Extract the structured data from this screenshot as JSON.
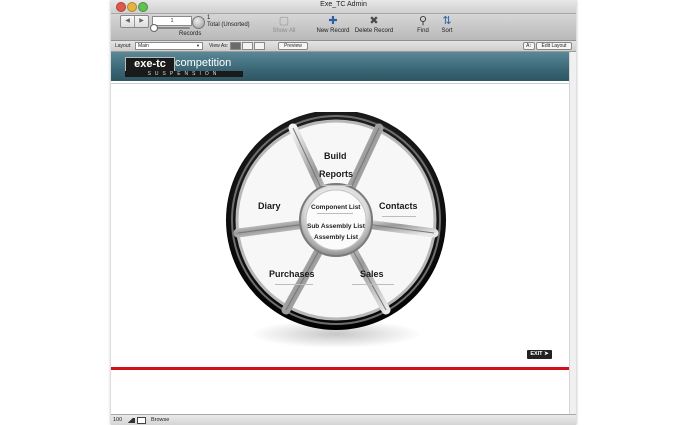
{
  "window": {
    "title": "Exe_TC Admin"
  },
  "toolbar": {
    "nav_prev": "◀",
    "nav_next": "▶",
    "record_input": "1",
    "record_number": "1",
    "record_total": "Total (Unsorted)",
    "records_label": "Records",
    "show_all": "Show All",
    "new_record": "New Record",
    "delete_record": "Delete Record",
    "find": "Find",
    "sort": "Sort"
  },
  "layoutbar": {
    "layout_label": "Layout:",
    "layout_value": "Main",
    "view_as_label": "View As:",
    "preview_label": "Preview",
    "aa_label": "A↑",
    "edit_layout_label": "Edit Layout"
  },
  "banner": {
    "logo_main": "exe-tc",
    "logo_secondary": "competition",
    "logo_sub": "SUSPENSION"
  },
  "wheel": {
    "build": "Build",
    "reports": "Reports",
    "diary": "Diary",
    "contacts": "Contacts",
    "purchases": "Purchases",
    "sales": "Sales",
    "component_list": "Component List",
    "sub_assembly_list": "Sub Assembly List",
    "assembly_list": "Assembly List"
  },
  "exit_button": "EXIT ➤",
  "statusbar": {
    "zoom": "100",
    "mode": "Browse"
  },
  "colors": {
    "banner": "#3a6676",
    "accent_line": "#d0101a"
  }
}
